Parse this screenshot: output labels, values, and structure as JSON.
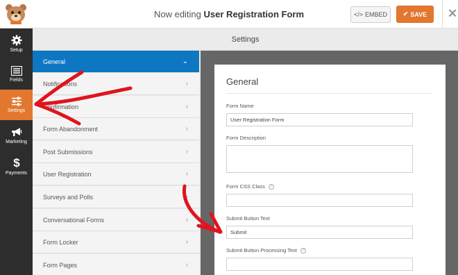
{
  "header": {
    "editing_prefix": "Now editing",
    "form_name": "User Registration Form",
    "embed_label": "EMBED",
    "save_label": "SAVE"
  },
  "leftnav": {
    "items": [
      {
        "label": "Setup",
        "icon": "gear-icon"
      },
      {
        "label": "Fields",
        "icon": "fields-list-icon"
      },
      {
        "label": "Settings",
        "icon": "sliders-icon"
      },
      {
        "label": "Marketing",
        "icon": "megaphone-icon"
      },
      {
        "label": "Payments",
        "icon": "dollar-icon"
      }
    ]
  },
  "settings_title": "Settings",
  "panels": [
    {
      "label": "General",
      "chevron": "⌄"
    },
    {
      "label": "Notifications",
      "chevron": "›"
    },
    {
      "label": "Confirmation",
      "chevron": "›"
    },
    {
      "label": "Form Abandonment",
      "chevron": "›"
    },
    {
      "label": "Post Submissions",
      "chevron": "›"
    },
    {
      "label": "User Registration",
      "chevron": "›"
    },
    {
      "label": "Surveys and Polls",
      "chevron": "›"
    },
    {
      "label": "Conversational Forms",
      "chevron": "›"
    },
    {
      "label": "Form Locker",
      "chevron": "›"
    },
    {
      "label": "Form Pages",
      "chevron": "›"
    }
  ],
  "general": {
    "title": "General",
    "form_name_label": "Form Name",
    "form_name_value": "User Registration Form",
    "form_description_label": "Form Description",
    "form_description_value": "",
    "css_class_label": "Form CSS Class",
    "css_class_value": "",
    "submit_text_label": "Submit Button Text",
    "submit_text_value": "Submit",
    "processing_text_label": "Submit Button Processing Text",
    "processing_text_value": ""
  },
  "colors": {
    "accent": "#e27730",
    "active_panel": "#0e77c1",
    "sidebar": "#2d2d2d",
    "annotation": "#e0141e"
  }
}
